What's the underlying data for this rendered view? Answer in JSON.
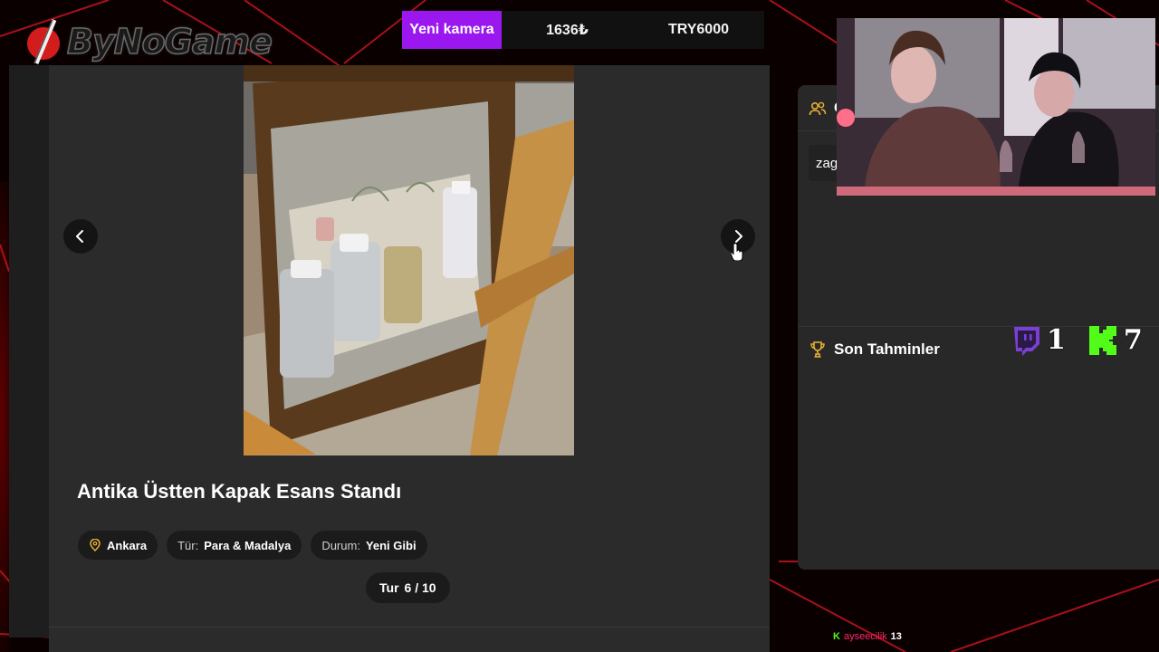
{
  "brand": {
    "logo_text": "ByNoGame"
  },
  "top_bar": {
    "new_camera_label": "Yeni kamera",
    "amount_try_symbol": "1636₺",
    "amount_try_code": "TRY6000"
  },
  "product": {
    "title": "Antika Üstten Kapak Esans Standı",
    "location": "Ankara",
    "type_label": "Tür:",
    "type_value": "Para & Madalya",
    "condition_label": "Durum:",
    "condition_value": "Yeni Gibi",
    "round_label": "Tur",
    "round_value": "6 / 10"
  },
  "right_panel": {
    "header_label": "C",
    "user_snippet": "zag",
    "predictions_title": "Son Tahminler"
  },
  "counters": {
    "twitch": "1",
    "kick": "7"
  },
  "chat": {
    "platform_icon": "K",
    "username": "ayseecilik",
    "message": "13"
  },
  "colors": {
    "accent_purple": "#9b17ef",
    "kick_green": "#53fc18",
    "twitch_purple": "#7b3fd3",
    "gold": "#e8b130"
  }
}
